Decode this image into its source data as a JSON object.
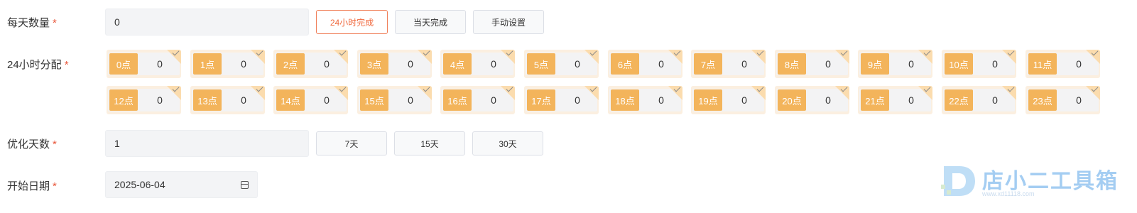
{
  "daily_count": {
    "label": "每天数量",
    "required_mark": "*",
    "value": "0",
    "buttons": [
      "24小时完成",
      "当天完成",
      "手动设置"
    ]
  },
  "hour_dist": {
    "label": "24小时分配",
    "required_mark": "*",
    "hours": [
      {
        "label": "0点",
        "value": "0"
      },
      {
        "label": "1点",
        "value": "0"
      },
      {
        "label": "2点",
        "value": "0"
      },
      {
        "label": "3点",
        "value": "0"
      },
      {
        "label": "4点",
        "value": "0"
      },
      {
        "label": "5点",
        "value": "0"
      },
      {
        "label": "6点",
        "value": "0"
      },
      {
        "label": "7点",
        "value": "0"
      },
      {
        "label": "8点",
        "value": "0"
      },
      {
        "label": "9点",
        "value": "0"
      },
      {
        "label": "10点",
        "value": "0"
      },
      {
        "label": "11点",
        "value": "0"
      },
      {
        "label": "12点",
        "value": "0"
      },
      {
        "label": "13点",
        "value": "0"
      },
      {
        "label": "14点",
        "value": "0"
      },
      {
        "label": "15点",
        "value": "0"
      },
      {
        "label": "16点",
        "value": "0"
      },
      {
        "label": "17点",
        "value": "0"
      },
      {
        "label": "18点",
        "value": "0"
      },
      {
        "label": "19点",
        "value": "0"
      },
      {
        "label": "20点",
        "value": "0"
      },
      {
        "label": "21点",
        "value": "0"
      },
      {
        "label": "22点",
        "value": "0"
      },
      {
        "label": "23点",
        "value": "0"
      }
    ]
  },
  "optimize_days": {
    "label": "优化天数",
    "required_mark": "*",
    "value": "1",
    "buttons": [
      "7天",
      "15天",
      "30天"
    ]
  },
  "start_date": {
    "label": "开始日期",
    "required_mark": "*",
    "value": "2025-06-04",
    "icon": "calendar-icon"
  },
  "watermark": {
    "text": "店小二工具箱",
    "url": "www.xd11118.com"
  },
  "colors": {
    "accent": "#f06a3f",
    "hour_tag": "#f3b45b",
    "required": "#e8563a"
  }
}
